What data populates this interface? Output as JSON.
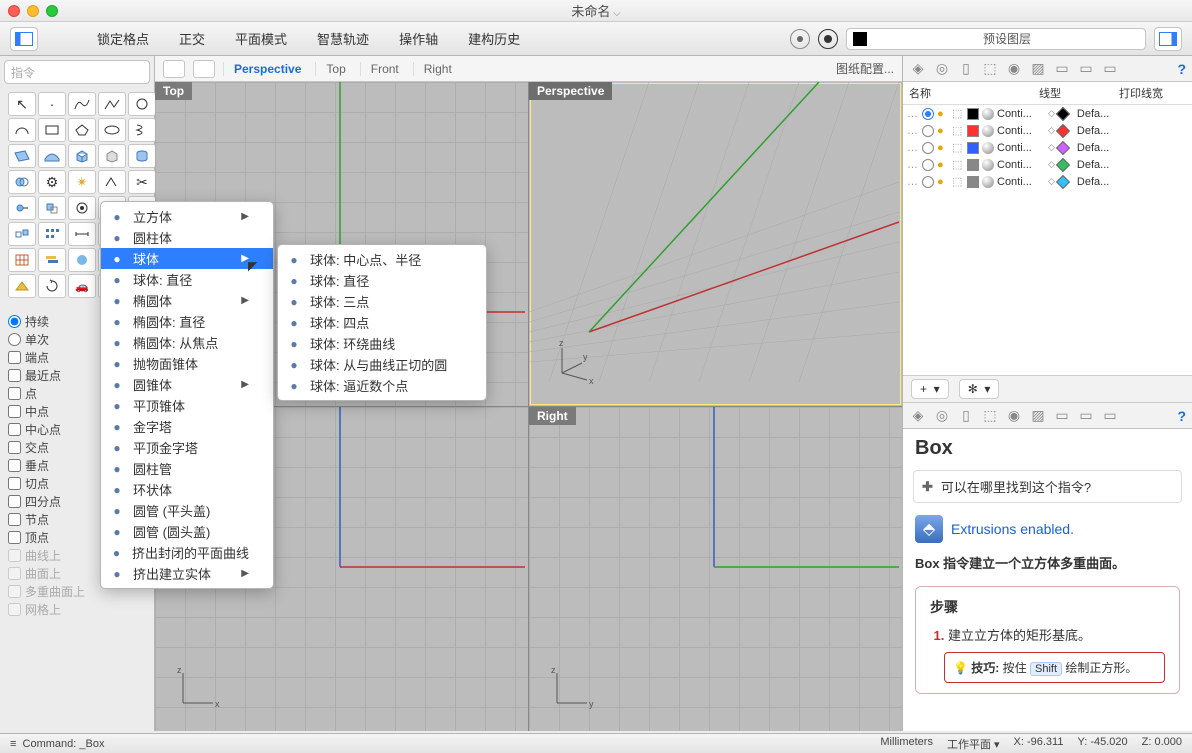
{
  "title": "未命名",
  "toolbar": {
    "menus": [
      "锁定格点",
      "正交",
      "平面模式",
      "智慧轨迹",
      "操作轴",
      "建构历史"
    ],
    "layer_label": "预设图层"
  },
  "command_placeholder": "指令",
  "viewtabs": {
    "active": "Perspective",
    "tabs": [
      "Perspective",
      "Top",
      "Front",
      "Right"
    ],
    "config": "图纸配置..."
  },
  "viewports": {
    "tl": "Top",
    "tr": "Perspective",
    "bl": "",
    "br": "Right"
  },
  "osnap": {
    "items": [
      {
        "label": "持续",
        "checked": true,
        "radio": true,
        "disabled": false
      },
      {
        "label": "单次",
        "checked": false,
        "radio": true,
        "disabled": false
      },
      {
        "label": "端点",
        "checked": false,
        "disabled": false
      },
      {
        "label": "最近点",
        "checked": false,
        "disabled": false
      },
      {
        "label": "点",
        "checked": false,
        "disabled": false
      },
      {
        "label": "中点",
        "checked": false,
        "disabled": false
      },
      {
        "label": "中心点",
        "checked": false,
        "disabled": false
      },
      {
        "label": "交点",
        "checked": false,
        "disabled": false
      },
      {
        "label": "垂点",
        "checked": false,
        "disabled": false
      },
      {
        "label": "切点",
        "checked": false,
        "disabled": false
      },
      {
        "label": "四分点",
        "checked": false,
        "disabled": false
      },
      {
        "label": "节点",
        "checked": false,
        "disabled": false
      },
      {
        "label": "顶点",
        "checked": false,
        "disabled": false
      },
      {
        "label": "曲线上",
        "checked": false,
        "disabled": true
      },
      {
        "label": "曲面上",
        "checked": false,
        "disabled": true
      },
      {
        "label": "多重曲面上",
        "checked": false,
        "disabled": true
      },
      {
        "label": "网格上",
        "checked": false,
        "disabled": true
      }
    ]
  },
  "ctx1": {
    "items": [
      {
        "label": "立方体",
        "arrow": true
      },
      {
        "label": "圆柱体"
      },
      {
        "label": "球体",
        "arrow": true,
        "highlight": true
      },
      {
        "label": "球体: 直径"
      },
      {
        "label": "椭圆体",
        "arrow": true
      },
      {
        "label": "椭圆体: 直径"
      },
      {
        "label": "椭圆体: 从焦点"
      },
      {
        "label": "抛物面锥体"
      },
      {
        "label": "圆锥体",
        "arrow": true
      },
      {
        "label": "平顶锥体"
      },
      {
        "label": "金字塔"
      },
      {
        "label": "平顶金字塔"
      },
      {
        "label": "圆柱管"
      },
      {
        "label": "环状体"
      },
      {
        "label": "圆管 (平头盖)"
      },
      {
        "label": "圆管 (圆头盖)"
      },
      {
        "label": "挤出封闭的平面曲线"
      },
      {
        "label": "挤出建立实体",
        "arrow": true
      }
    ]
  },
  "ctx2": {
    "items": [
      {
        "label": "球体: 中心点、半径"
      },
      {
        "label": "球体: 直径"
      },
      {
        "label": "球体: 三点"
      },
      {
        "label": "球体: 四点"
      },
      {
        "label": "球体: 环绕曲线"
      },
      {
        "label": "球体: 从与曲线正切的圆"
      },
      {
        "label": "球体: 逼近数个点"
      }
    ]
  },
  "layers": {
    "header": [
      "名称",
      "线型",
      "打印线宽"
    ],
    "rows": [
      {
        "color": "#000000",
        "diam": "#000000",
        "lt": "Conti...",
        "lw": "Defa...",
        "active": true
      },
      {
        "color": "#ff3030",
        "diam": "#ff3030",
        "lt": "Conti...",
        "lw": "Defa..."
      },
      {
        "color": "#3060ff",
        "diam": "#d060ff",
        "lt": "Conti...",
        "lw": "Defa..."
      },
      {
        "color": "#888888",
        "diam": "#30c060",
        "lt": "Conti...",
        "lw": "Defa..."
      },
      {
        "color": "#888888",
        "diam": "#30c0ff",
        "lt": "Conti...",
        "lw": "Defa..."
      }
    ]
  },
  "help": {
    "title": "Box",
    "finder": "可以在哪里找到这个指令?",
    "ext": "Extrusions enabled.",
    "desc": "Box 指令建立一个立方体多重曲面。",
    "steps_title": "步骤",
    "step1": "建立立方体的矩形基底。",
    "tip_label": "技巧:",
    "tip_hold": "按住",
    "tip_key": "Shift",
    "tip_rest": "绘制正方形。"
  },
  "status": {
    "left_label": "Command:",
    "left_cmd": "_Box",
    "units": "Millimeters",
    "plane_label": "工作平面",
    "x": "X: -96.311",
    "y": "Y: -45.020",
    "z": "Z: 0.000"
  }
}
